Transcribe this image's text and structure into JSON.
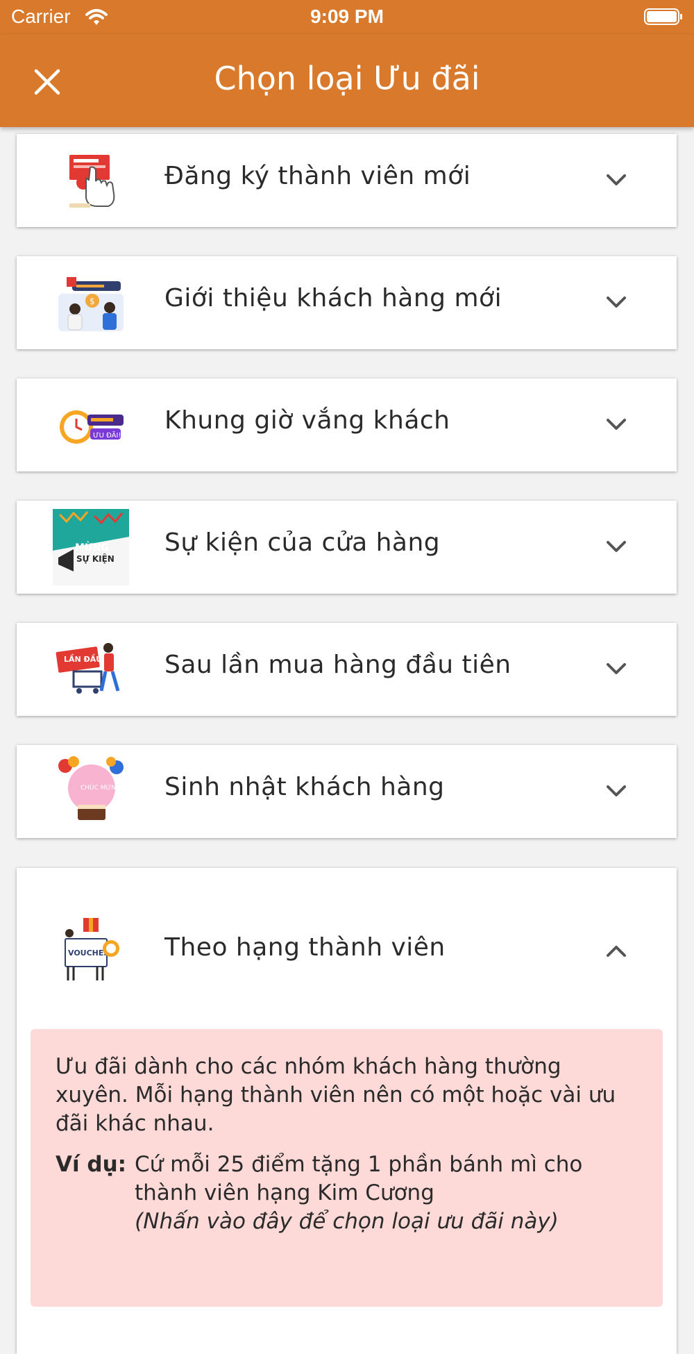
{
  "status": {
    "carrier": "Carrier",
    "time": "9:09 PM"
  },
  "header": {
    "title": "Chọn loại Ưu đãi",
    "close_icon": "close-icon"
  },
  "colors": {
    "accent": "#d9792b",
    "highlight": "#fddad8"
  },
  "options": [
    {
      "label": "Đăng ký thành viên mới",
      "icon": "signup-illustration",
      "expanded": false
    },
    {
      "label": "Giới thiệu khách hàng mới",
      "icon": "referral-illustration",
      "expanded": false
    },
    {
      "label": "Khung giờ vắng khách",
      "icon": "clock-illustration",
      "expanded": false
    },
    {
      "label": "Sự kiện của cửa hàng",
      "icon": "event-illustration",
      "expanded": false
    },
    {
      "label": "Sau lần mua hàng đầu tiên",
      "icon": "first-purchase-illustration",
      "expanded": false
    },
    {
      "label": "Sinh nhật khách hàng",
      "icon": "birthday-illustration",
      "expanded": false
    },
    {
      "label": "Theo hạng thành viên",
      "icon": "voucher-illustration",
      "expanded": true
    }
  ],
  "detail": {
    "description": "Ưu đãi dành cho các nhóm khách hàng thường xuyên. Mỗi hạng thành viên nên có một hoặc vài ưu đãi khác nhau.",
    "example_label": "Ví dụ:",
    "example_text": "Cứ mỗi 25 điểm tặng 1 phần bánh mì cho thành viên hạng Kim Cương",
    "hint": "(Nhấn vào đây để chọn loại ưu đãi này)"
  }
}
